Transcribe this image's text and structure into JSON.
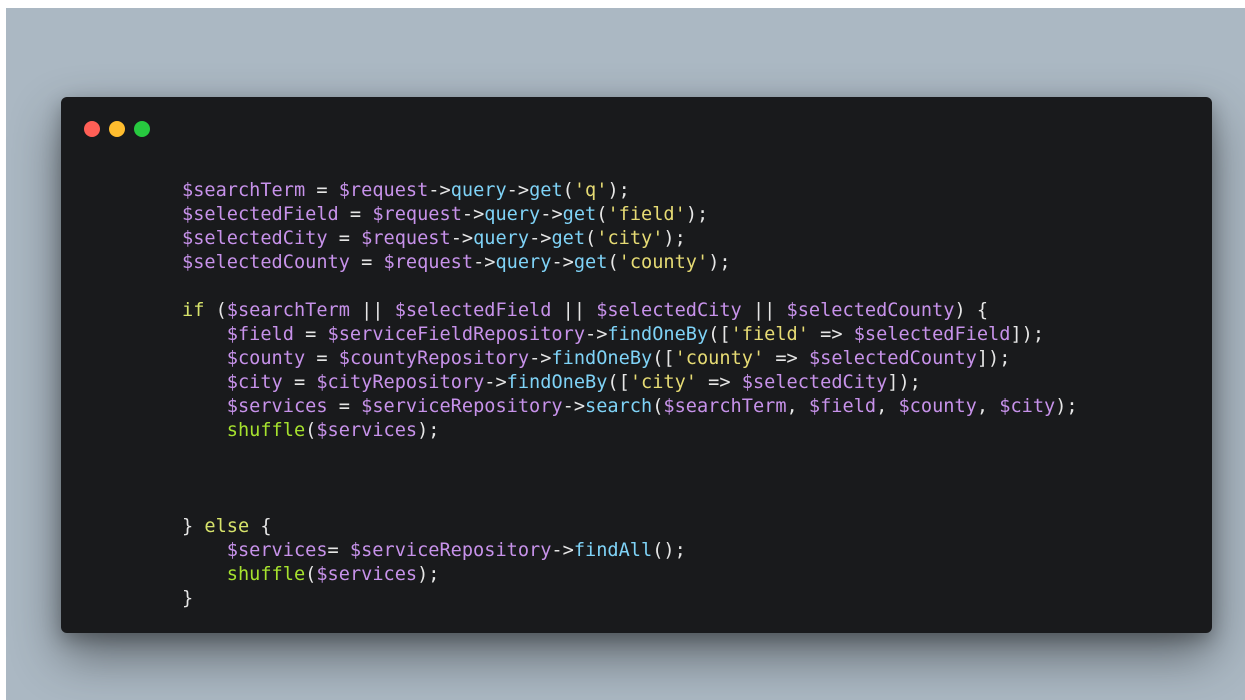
{
  "window": {
    "controls": {
      "close": {
        "icon": "close-icon",
        "color": "#ff5f56"
      },
      "minimize": {
        "icon": "minimize-icon",
        "color": "#ffbd2e"
      },
      "maximize": {
        "icon": "maximize-icon",
        "color": "#27c93f"
      }
    }
  },
  "colors": {
    "background": "#abb8c3",
    "window": "#191a1c",
    "variable": "#c792ea",
    "method": "#7fd3f7",
    "function": "#a6e22e",
    "string": "#e6db74",
    "keyword": "#d7e36b",
    "operator": "#e6e6e6"
  },
  "code_lines": [
    [
      {
        "t": "$searchTerm",
        "c": "variable"
      },
      {
        "t": " = ",
        "c": "operator"
      },
      {
        "t": "$request",
        "c": "variable"
      },
      {
        "t": "->",
        "c": "operator"
      },
      {
        "t": "query",
        "c": "method"
      },
      {
        "t": "->",
        "c": "operator"
      },
      {
        "t": "get",
        "c": "method"
      },
      {
        "t": "(",
        "c": "operator"
      },
      {
        "t": "'q'",
        "c": "string"
      },
      {
        "t": ");",
        "c": "operator"
      }
    ],
    [
      {
        "t": "$selectedField",
        "c": "variable"
      },
      {
        "t": " = ",
        "c": "operator"
      },
      {
        "t": "$request",
        "c": "variable"
      },
      {
        "t": "->",
        "c": "operator"
      },
      {
        "t": "query",
        "c": "method"
      },
      {
        "t": "->",
        "c": "operator"
      },
      {
        "t": "get",
        "c": "method"
      },
      {
        "t": "(",
        "c": "operator"
      },
      {
        "t": "'field'",
        "c": "string"
      },
      {
        "t": ");",
        "c": "operator"
      }
    ],
    [
      {
        "t": "$selectedCity",
        "c": "variable"
      },
      {
        "t": " = ",
        "c": "operator"
      },
      {
        "t": "$request",
        "c": "variable"
      },
      {
        "t": "->",
        "c": "operator"
      },
      {
        "t": "query",
        "c": "method"
      },
      {
        "t": "->",
        "c": "operator"
      },
      {
        "t": "get",
        "c": "method"
      },
      {
        "t": "(",
        "c": "operator"
      },
      {
        "t": "'city'",
        "c": "string"
      },
      {
        "t": ");",
        "c": "operator"
      }
    ],
    [
      {
        "t": "$selectedCounty",
        "c": "variable"
      },
      {
        "t": " = ",
        "c": "operator"
      },
      {
        "t": "$request",
        "c": "variable"
      },
      {
        "t": "->",
        "c": "operator"
      },
      {
        "t": "query",
        "c": "method"
      },
      {
        "t": "->",
        "c": "operator"
      },
      {
        "t": "get",
        "c": "method"
      },
      {
        "t": "(",
        "c": "operator"
      },
      {
        "t": "'county'",
        "c": "string"
      },
      {
        "t": ");",
        "c": "operator"
      }
    ],
    [],
    [
      {
        "t": "if",
        "c": "keyword"
      },
      {
        "t": " (",
        "c": "operator"
      },
      {
        "t": "$searchTerm",
        "c": "variable"
      },
      {
        "t": " || ",
        "c": "operator"
      },
      {
        "t": "$selectedField",
        "c": "variable"
      },
      {
        "t": " || ",
        "c": "operator"
      },
      {
        "t": "$selectedCity",
        "c": "variable"
      },
      {
        "t": " || ",
        "c": "operator"
      },
      {
        "t": "$selectedCounty",
        "c": "variable"
      },
      {
        "t": ") {",
        "c": "operator"
      }
    ],
    [
      {
        "t": "    ",
        "c": "operator"
      },
      {
        "t": "$field",
        "c": "variable"
      },
      {
        "t": " = ",
        "c": "operator"
      },
      {
        "t": "$serviceFieldRepository",
        "c": "variable"
      },
      {
        "t": "->",
        "c": "operator"
      },
      {
        "t": "findOneBy",
        "c": "method"
      },
      {
        "t": "([",
        "c": "operator"
      },
      {
        "t": "'field'",
        "c": "string"
      },
      {
        "t": " => ",
        "c": "operator"
      },
      {
        "t": "$selectedField",
        "c": "variable"
      },
      {
        "t": "]);",
        "c": "operator"
      }
    ],
    [
      {
        "t": "    ",
        "c": "operator"
      },
      {
        "t": "$county",
        "c": "variable"
      },
      {
        "t": " = ",
        "c": "operator"
      },
      {
        "t": "$countyRepository",
        "c": "variable"
      },
      {
        "t": "->",
        "c": "operator"
      },
      {
        "t": "findOneBy",
        "c": "method"
      },
      {
        "t": "([",
        "c": "operator"
      },
      {
        "t": "'county'",
        "c": "string"
      },
      {
        "t": " => ",
        "c": "operator"
      },
      {
        "t": "$selectedCounty",
        "c": "variable"
      },
      {
        "t": "]);",
        "c": "operator"
      }
    ],
    [
      {
        "t": "    ",
        "c": "operator"
      },
      {
        "t": "$city",
        "c": "variable"
      },
      {
        "t": " = ",
        "c": "operator"
      },
      {
        "t": "$cityRepository",
        "c": "variable"
      },
      {
        "t": "->",
        "c": "operator"
      },
      {
        "t": "findOneBy",
        "c": "method"
      },
      {
        "t": "([",
        "c": "operator"
      },
      {
        "t": "'city'",
        "c": "string"
      },
      {
        "t": " => ",
        "c": "operator"
      },
      {
        "t": "$selectedCity",
        "c": "variable"
      },
      {
        "t": "]);",
        "c": "operator"
      }
    ],
    [
      {
        "t": "    ",
        "c": "operator"
      },
      {
        "t": "$services",
        "c": "variable"
      },
      {
        "t": " = ",
        "c": "operator"
      },
      {
        "t": "$serviceRepository",
        "c": "variable"
      },
      {
        "t": "->",
        "c": "operator"
      },
      {
        "t": "search",
        "c": "method"
      },
      {
        "t": "(",
        "c": "operator"
      },
      {
        "t": "$searchTerm",
        "c": "variable"
      },
      {
        "t": ", ",
        "c": "operator"
      },
      {
        "t": "$field",
        "c": "variable"
      },
      {
        "t": ", ",
        "c": "operator"
      },
      {
        "t": "$county",
        "c": "variable"
      },
      {
        "t": ", ",
        "c": "operator"
      },
      {
        "t": "$city",
        "c": "variable"
      },
      {
        "t": ");",
        "c": "operator"
      }
    ],
    [
      {
        "t": "    ",
        "c": "operator"
      },
      {
        "t": "shuffle",
        "c": "function"
      },
      {
        "t": "(",
        "c": "operator"
      },
      {
        "t": "$services",
        "c": "variable"
      },
      {
        "t": ");",
        "c": "operator"
      }
    ],
    [],
    [],
    [],
    [
      {
        "t": "} ",
        "c": "operator"
      },
      {
        "t": "else",
        "c": "keyword"
      },
      {
        "t": " {",
        "c": "operator"
      }
    ],
    [
      {
        "t": "    ",
        "c": "operator"
      },
      {
        "t": "$services",
        "c": "variable"
      },
      {
        "t": "= ",
        "c": "operator"
      },
      {
        "t": "$serviceRepository",
        "c": "variable"
      },
      {
        "t": "->",
        "c": "operator"
      },
      {
        "t": "findAll",
        "c": "method"
      },
      {
        "t": "();",
        "c": "operator"
      }
    ],
    [
      {
        "t": "    ",
        "c": "operator"
      },
      {
        "t": "shuffle",
        "c": "function"
      },
      {
        "t": "(",
        "c": "operator"
      },
      {
        "t": "$services",
        "c": "variable"
      },
      {
        "t": ");",
        "c": "operator"
      }
    ],
    [
      {
        "t": "}",
        "c": "operator"
      }
    ]
  ]
}
